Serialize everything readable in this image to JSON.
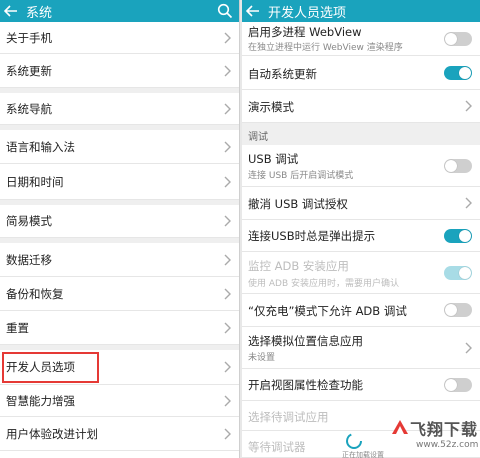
{
  "left": {
    "title": "系统",
    "items": [
      {
        "label": "关于手机"
      },
      {
        "label": "系统更新"
      },
      {
        "label": "系统导航"
      },
      {
        "label": "语言和输入法"
      },
      {
        "label": "日期和时间"
      },
      {
        "label": "简易模式"
      },
      {
        "label": "数据迁移"
      },
      {
        "label": "备份和恢复"
      },
      {
        "label": "重置"
      },
      {
        "label": "开发人员选项"
      },
      {
        "label": "智慧能力增强"
      },
      {
        "label": "用户体验改进计划"
      }
    ]
  },
  "right": {
    "title": "开发人员选项",
    "rows": [
      {
        "title": "启用多进程 WebView",
        "subtitle": "在独立进程中运行 WebView 渲染程序"
      },
      {
        "title": "自动系统更新"
      },
      {
        "title": "演示模式"
      },
      {
        "title": "USB 调试",
        "subtitle": "连接 USB 后开启调试模式"
      },
      {
        "title": "撤消 USB 调试授权"
      },
      {
        "title": "连接USB时总是弹出提示"
      },
      {
        "title": "监控 ADB 安装应用",
        "subtitle": "使用 ADB 安装应用时，需要用户确认"
      },
      {
        "title": "“仅充电”模式下允许 ADB 调试"
      },
      {
        "title": "选择模拟位置信息应用",
        "subtitle": "未设置"
      },
      {
        "title": "开启视图属性检查功能"
      },
      {
        "title": "选择待调试应用"
      },
      {
        "title": "等待调试器"
      }
    ],
    "section_label": "调试"
  },
  "colors": {
    "accent": "#1aa3bd",
    "highlight": "#e53935"
  },
  "icons": {
    "back": "back-arrow-icon",
    "search": "search-icon",
    "chevron": "chevron-right-icon"
  },
  "loader_text": "正在加载设置",
  "watermark": {
    "title": "飞翔下载",
    "url": "www.52z.com"
  }
}
